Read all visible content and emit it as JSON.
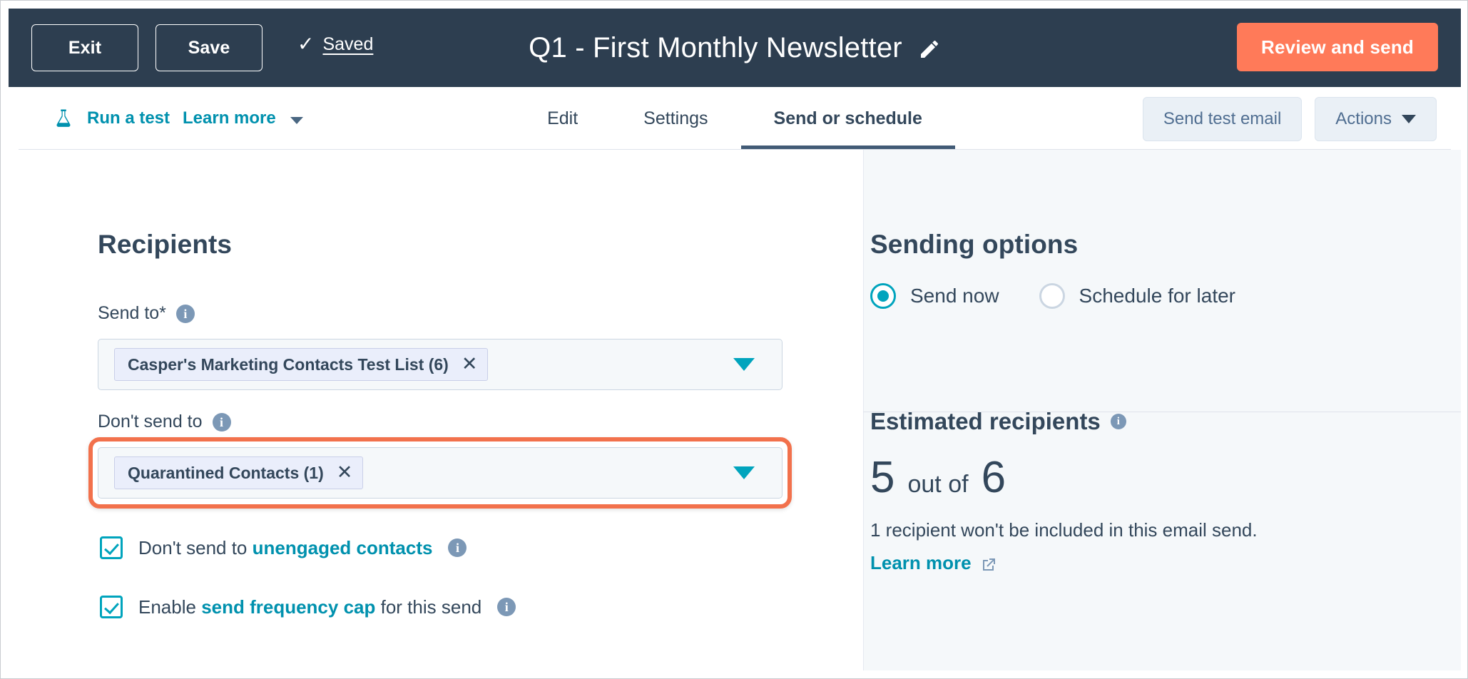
{
  "topbar": {
    "exit_label": "Exit",
    "save_label": "Save",
    "saved_label": "Saved",
    "saved_check_icon": "check-icon",
    "doc_title": "Q1 - First Monthly Newsletter",
    "edit_title_icon": "pencil-icon",
    "review_send_label": "Review and send",
    "accent_color": "#ff7a59",
    "background_color": "#2d3e50"
  },
  "navbar": {
    "flask_icon": "flask-icon",
    "run_test_label": "Run a test",
    "learn_more_label": "Learn more",
    "tabs": [
      {
        "label": "Edit",
        "active": false
      },
      {
        "label": "Settings",
        "active": false
      },
      {
        "label": "Send or schedule",
        "active": true
      }
    ],
    "send_test_email_label": "Send test email",
    "actions_label": "Actions",
    "link_color": "#0091ae"
  },
  "recipients": {
    "title": "Recipients",
    "send_to": {
      "label": "Send to*",
      "info_icon": "info-icon",
      "token": "Casper's Marketing Contacts Test List (6)",
      "token_remove_icon": "close-icon",
      "caret_icon": "chevron-down-icon"
    },
    "dont_send_to": {
      "label": "Don't send to",
      "info_icon": "info-icon",
      "token": "Quarantined Contacts (1)",
      "token_remove_icon": "close-icon",
      "caret_icon": "chevron-down-icon",
      "highlight_color": "#f2714c"
    },
    "checkboxes": [
      {
        "checked": true,
        "text_before": "Don't send to ",
        "link_text": "unengaged contacts",
        "text_after": "",
        "info_icon": "info-icon"
      },
      {
        "checked": true,
        "text_before": "Enable ",
        "link_text": "send frequency cap",
        "text_after": " for this send",
        "info_icon": "info-icon"
      }
    ]
  },
  "sending_options": {
    "title": "Sending options",
    "options": [
      {
        "label": "Send now",
        "selected": true
      },
      {
        "label": "Schedule for later",
        "selected": false
      }
    ],
    "selected_color": "#00a4bd"
  },
  "estimated_recipients": {
    "title": "Estimated recipients",
    "info_icon": "info-icon",
    "count": "5",
    "out_of_label": "out of",
    "total": "6",
    "note": "1 recipient won't be included in this email send.",
    "learn_more_label": "Learn more",
    "external_link_icon": "external-link-icon"
  }
}
